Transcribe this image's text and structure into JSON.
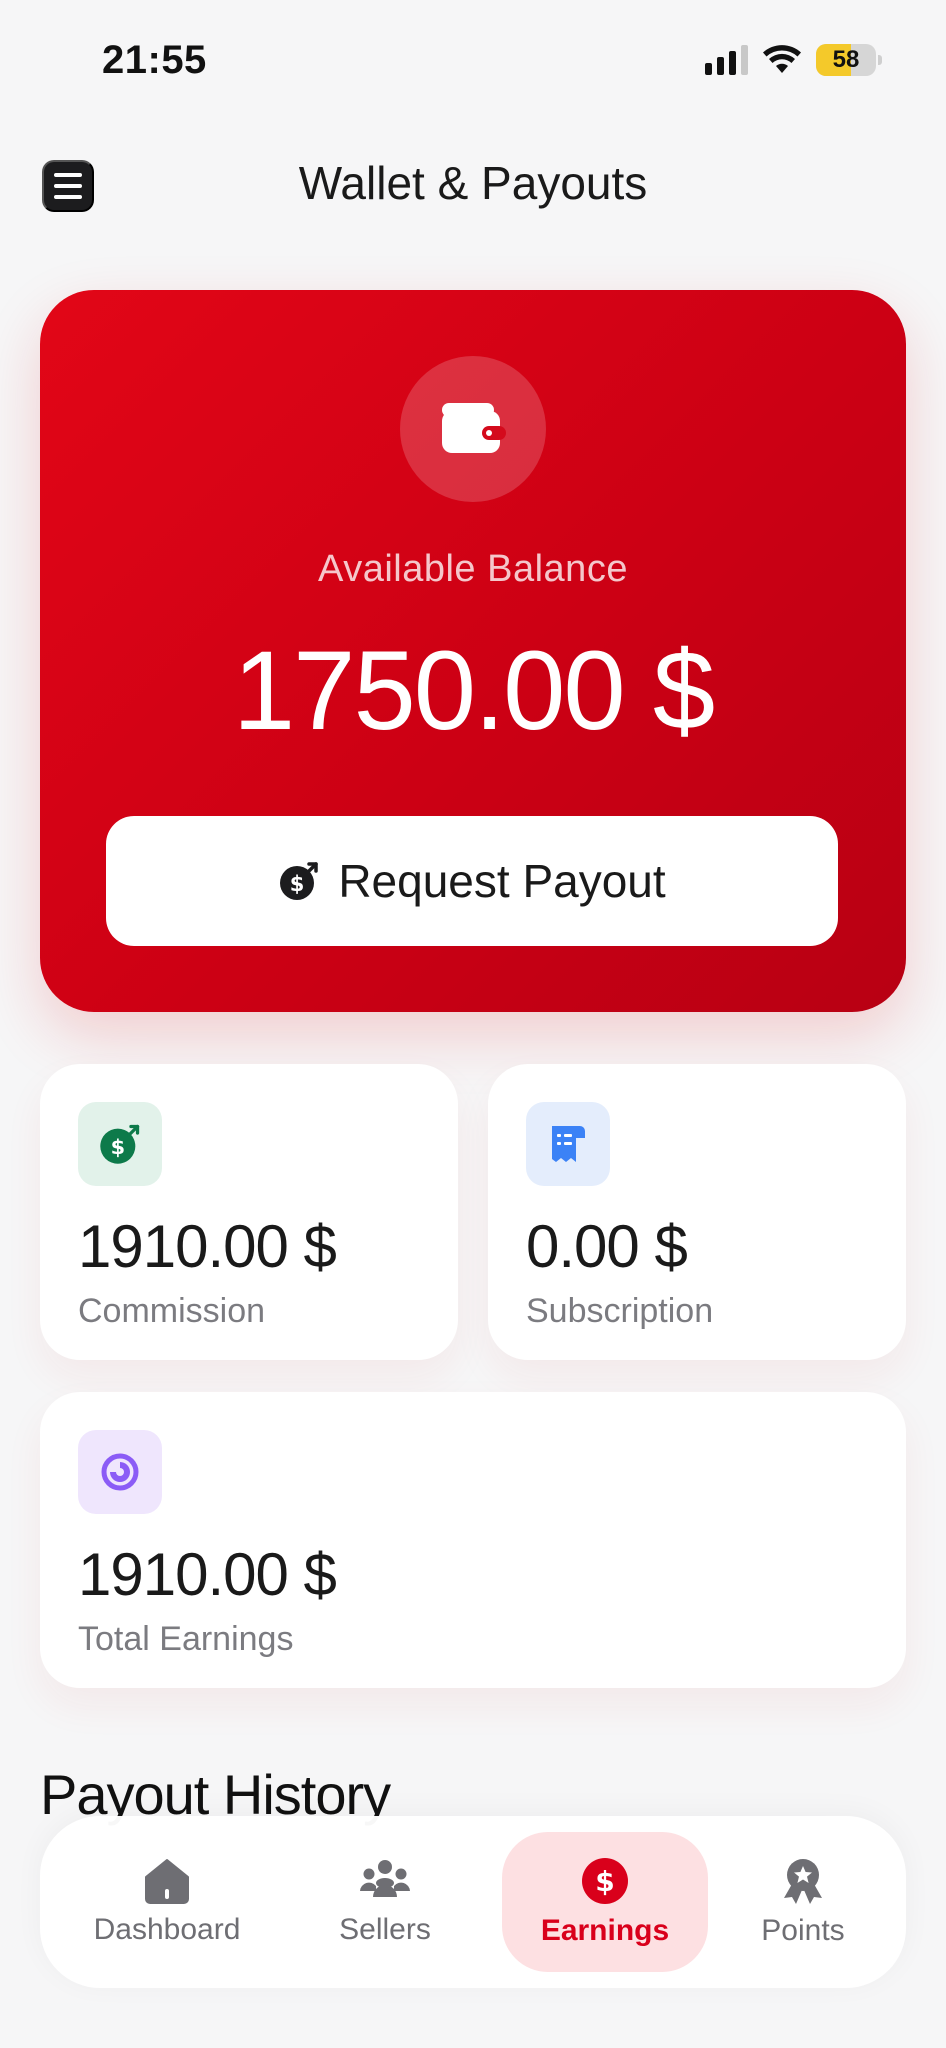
{
  "status_bar": {
    "time": "21:55",
    "battery": "58",
    "battery_level": 0.58
  },
  "header": {
    "title": "Wallet & Payouts"
  },
  "balance": {
    "label": "Available Balance",
    "amount": "1750.00 $",
    "button_label": "Request Payout"
  },
  "stats": {
    "commission": {
      "value": "1910.00 $",
      "label": "Commission"
    },
    "subscription": {
      "value": "0.00 $",
      "label": "Subscription"
    },
    "total": {
      "value": "1910.00 $",
      "label": "Total Earnings"
    }
  },
  "section": {
    "title": "Payout History"
  },
  "nav": {
    "items": [
      {
        "label": "Dashboard",
        "icon": "home-icon"
      },
      {
        "label": "Sellers",
        "icon": "users-icon"
      },
      {
        "label": "Earnings",
        "icon": "dollar-icon",
        "active": true
      },
      {
        "label": "Points",
        "icon": "award-icon"
      }
    ]
  },
  "colors": {
    "brand_red": "#d9001b",
    "commission_green": "#0d7a4a",
    "subscription_blue": "#3b82f6",
    "total_purple": "#8b5cf6"
  }
}
